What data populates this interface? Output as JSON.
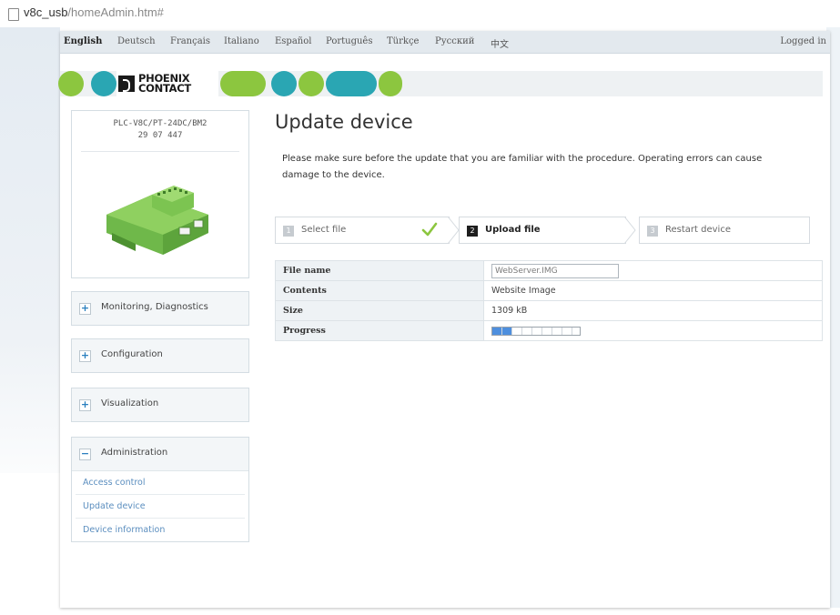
{
  "browser": {
    "url_main": "v8c_usb",
    "url_rest": "/homeAdmin.htm#"
  },
  "languages": [
    "English",
    "Deutsch",
    "Français",
    "Italiano",
    "Español",
    "Português",
    "Türkçe",
    "Русский",
    "中文"
  ],
  "active_language": "English",
  "session": {
    "status": "Logged in"
  },
  "brand": {
    "logo_line1": "PHOENIX",
    "logo_line2": "CONTACT",
    "green": "#8cc63f",
    "teal": "#2aa6b3"
  },
  "device": {
    "model": "PLC-V8C/PT-24DC/BM2",
    "article_no": "29 07 447"
  },
  "menu": {
    "monitoring": {
      "label": "Monitoring, Diagnostics",
      "sign": "+"
    },
    "configuration": {
      "label": "Configuration",
      "sign": "+"
    },
    "visualization": {
      "label": "Visualization",
      "sign": "+"
    },
    "administration": {
      "label": "Administration",
      "sign": "−"
    },
    "admin_items": [
      "Access control",
      "Update device",
      "Device information"
    ]
  },
  "main": {
    "title": "Update device",
    "intro": "Please make sure before the update that you are familiar with the procedure. Operating errors can cause damage to the device.",
    "steps": [
      {
        "num": "1",
        "label": "Select file"
      },
      {
        "num": "2",
        "label": "Upload file"
      },
      {
        "num": "3",
        "label": "Restart device"
      }
    ],
    "table": {
      "file_name_label": "File name",
      "file_name_value": "WebServer.IMG",
      "contents_label": "Contents",
      "contents_value": "Website Image",
      "size_label": "Size",
      "size_value": "1309 kB",
      "progress_label": "Progress",
      "progress_fraction": 0.22
    }
  }
}
